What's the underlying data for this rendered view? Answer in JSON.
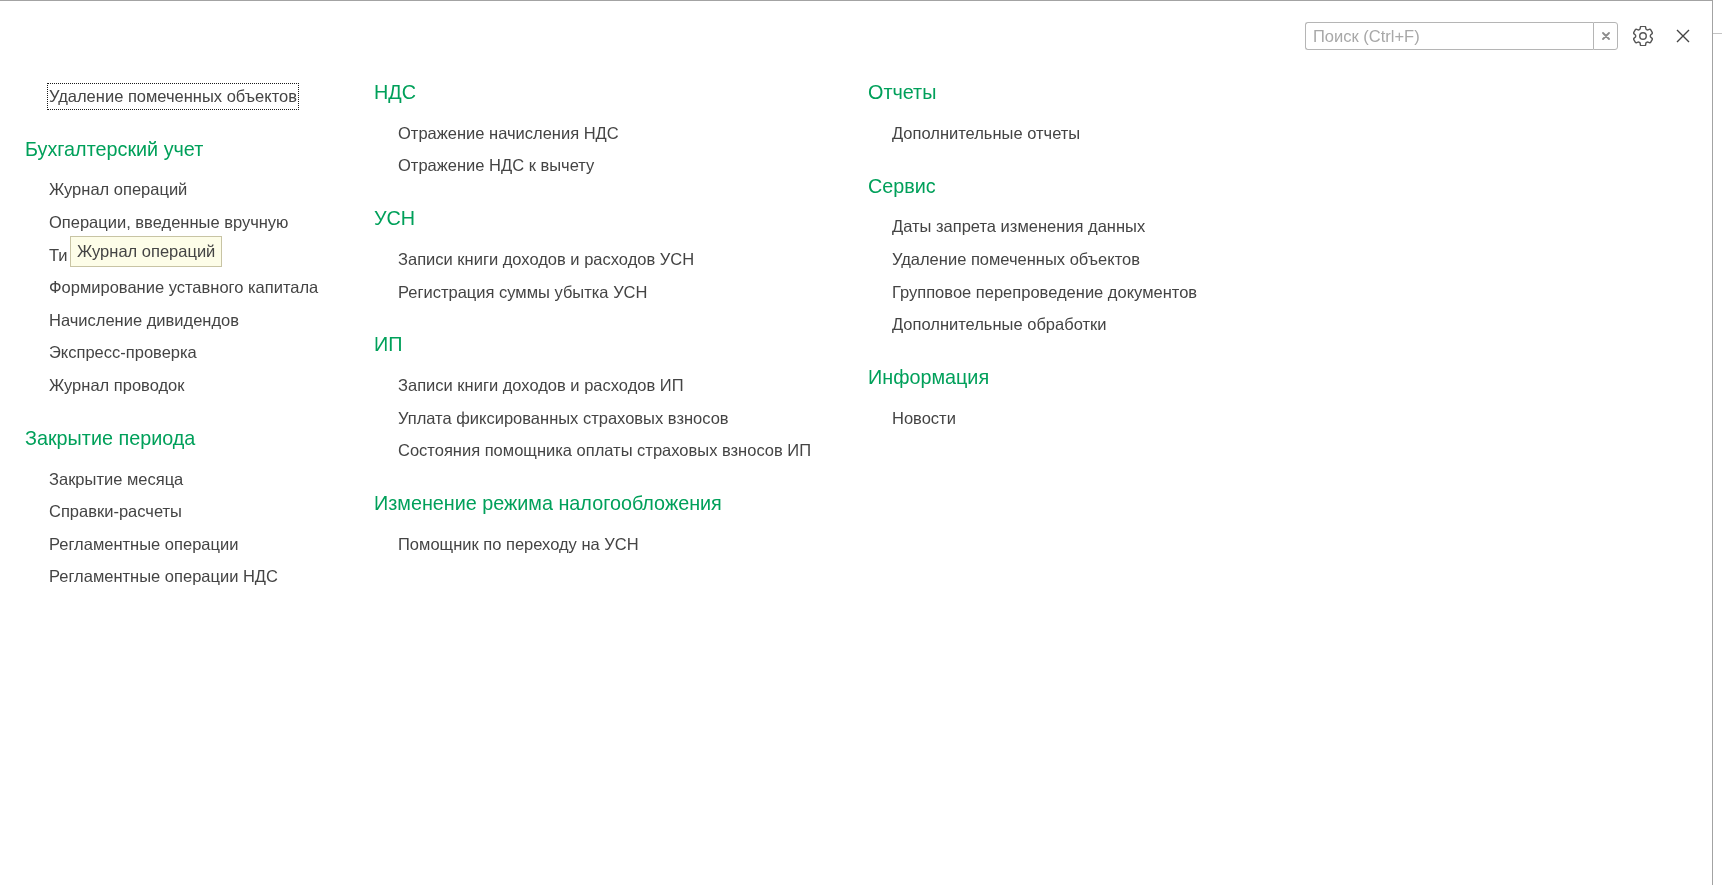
{
  "search": {
    "placeholder": "Поиск (Ctrl+F)"
  },
  "columns": [
    {
      "groups": [
        {
          "items": [
            {
              "label": "Удаление помеченных объектов",
              "focused": true
            }
          ]
        },
        {
          "heading": "Бухгалтерский учет",
          "items": [
            {
              "label": "Журнал операций",
              "focused": false
            },
            {
              "label": "Операции, введенные вручную",
              "focused": false
            },
            {
              "label": "Ти",
              "focused": false
            },
            {
              "label": "Формирование уставного капитала",
              "focused": false
            },
            {
              "label": "Начисление дивидендов",
              "focused": false
            },
            {
              "label": "Экспресс-проверка",
              "focused": false
            },
            {
              "label": "Журнал проводок",
              "focused": false
            }
          ]
        },
        {
          "heading": "Закрытие периода",
          "items": [
            {
              "label": "Закрытие месяца",
              "focused": false
            },
            {
              "label": "Справки-расчеты",
              "focused": false
            },
            {
              "label": "Регламентные операции",
              "focused": false
            },
            {
              "label": "Регламентные операции НДС",
              "focused": false
            }
          ]
        }
      ]
    },
    {
      "groups": [
        {
          "heading": "НДС",
          "items": [
            {
              "label": "Отражение начисления НДС",
              "focused": false
            },
            {
              "label": "Отражение НДС к вычету",
              "focused": false
            }
          ]
        },
        {
          "heading": "УСН",
          "items": [
            {
              "label": "Записи книги доходов и расходов УСН",
              "focused": false
            },
            {
              "label": "Регистрация суммы убытка УСН",
              "focused": false
            }
          ]
        },
        {
          "heading": "ИП",
          "items": [
            {
              "label": "Записи книги доходов и расходов ИП",
              "focused": false
            },
            {
              "label": "Уплата фиксированных страховых взносов",
              "focused": false
            },
            {
              "label": "Состояния помощника оплаты страховых взносов ИП",
              "focused": false
            }
          ]
        },
        {
          "heading": "Изменение режима налогообложения",
          "items": [
            {
              "label": "Помощник по переходу на УСН",
              "focused": false
            }
          ]
        }
      ]
    },
    {
      "groups": [
        {
          "heading": "Отчеты",
          "items": [
            {
              "label": "Дополнительные отчеты",
              "focused": false
            }
          ]
        },
        {
          "heading": "Сервис",
          "items": [
            {
              "label": "Даты запрета изменения данных",
              "focused": false
            },
            {
              "label": "Удаление помеченных объектов",
              "focused": false
            },
            {
              "label": "Групповое перепроведение документов",
              "focused": false
            },
            {
              "label": "Дополнительные обработки",
              "focused": false
            }
          ]
        },
        {
          "heading": "Информация",
          "items": [
            {
              "label": "Новости",
              "focused": false
            }
          ]
        }
      ]
    }
  ],
  "tooltip": {
    "text": "Журнал операций"
  }
}
